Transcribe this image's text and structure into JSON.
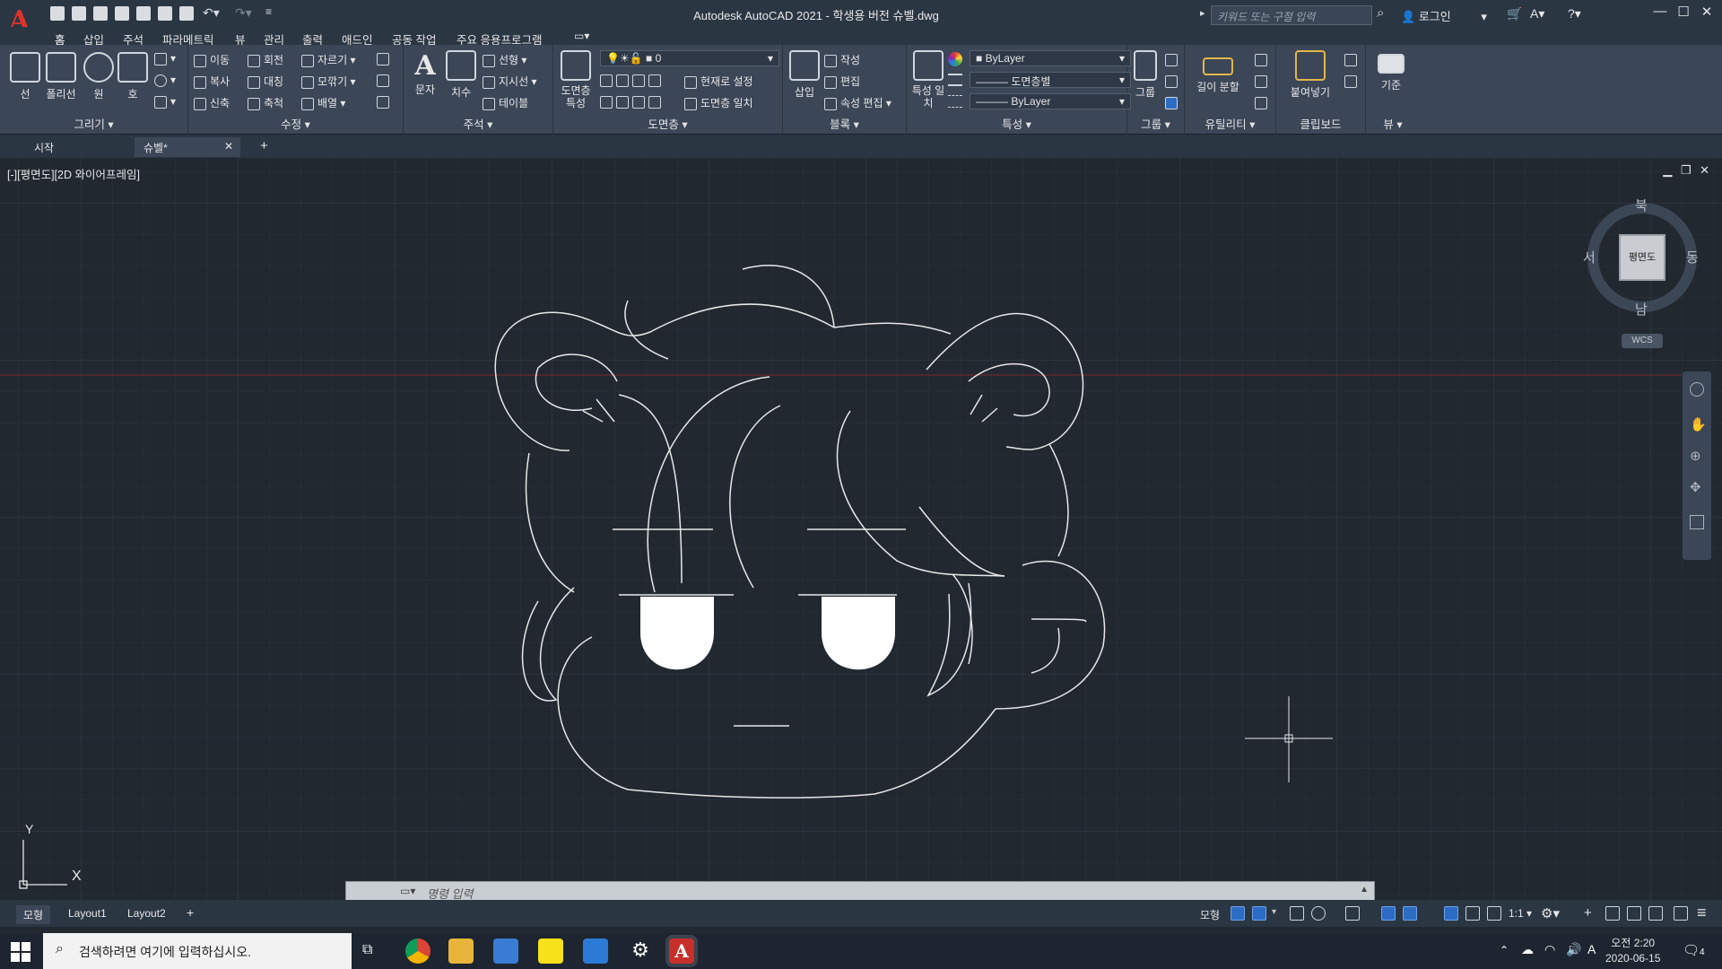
{
  "title_bar": {
    "title": "Autodesk AutoCAD 2021 - 학생용 버전    슈벨.dwg",
    "search_placeholder": "키워드 또는 구절 입력",
    "user_label": "로그인"
  },
  "menu_tabs": [
    "홈",
    "삽입",
    "주석",
    "파라메트릭",
    "뷰",
    "관리",
    "출력",
    "애드인",
    "공동 작업",
    "주요 응용프로그램"
  ],
  "ribbon": {
    "draw": {
      "title": "그리기 ▾",
      "line": "선",
      "polyline": "폴리선",
      "circle": "원",
      "arc": "호"
    },
    "modify": {
      "title": "수정 ▾",
      "move": "이동",
      "rotate": "회전",
      "trim": "자르기",
      "copy": "복사",
      "mirror": "대칭",
      "fillet": "모깎기",
      "stretch": "신축",
      "scale": "축척",
      "array": "배열"
    },
    "annotation": {
      "title": "주석 ▾",
      "text": "문자",
      "dim": "치수",
      "linear": "선형",
      "leader": "지시선",
      "table": "테이블"
    },
    "layers": {
      "title": "도면층 ▾",
      "props": "도면층 특성",
      "current_layer": "0",
      "make_current": "현재로 설정",
      "match": "도면층 일치"
    },
    "block": {
      "title": "블록 ▾",
      "insert": "삽입",
      "create": "작성",
      "edit": "편집",
      "attr_edit": "속성 편집"
    },
    "properties": {
      "title": "특성 ▾",
      "match": "특성 일치",
      "color": "ByLayer",
      "linetype": "도면층별",
      "lineweight": "ByLayer"
    },
    "groups": {
      "title": "그룹 ▾",
      "group": "그룹"
    },
    "utilities": {
      "title": "유틸리티 ▾",
      "measure": "길이 분할"
    },
    "clipboard": {
      "title": "클립보드",
      "paste": "붙여넣기"
    },
    "view": {
      "title": "뷰 ▾",
      "base": "기준"
    }
  },
  "doc_tabs": {
    "start": "시작",
    "current": "슈벨*"
  },
  "viewport": {
    "label": "[-][평면도][2D 와이어프레임]"
  },
  "viewcube": {
    "face": "평면도",
    "north": "북",
    "south": "남",
    "east": "동",
    "west": "서",
    "wcs": "WCS"
  },
  "command": {
    "placeholder": "명령 입력"
  },
  "layout_tabs": [
    "모형",
    "Layout1",
    "Layout2"
  ],
  "status": {
    "model": "모형",
    "scale": "1:1"
  },
  "taskbar": {
    "search": "검색하려면 여기에 입력하십시오.",
    "time": "오전 2:20",
    "date": "2020-06-15",
    "notifications": "4",
    "ime": "A"
  },
  "ucs": {
    "x": "X",
    "y": "Y"
  }
}
